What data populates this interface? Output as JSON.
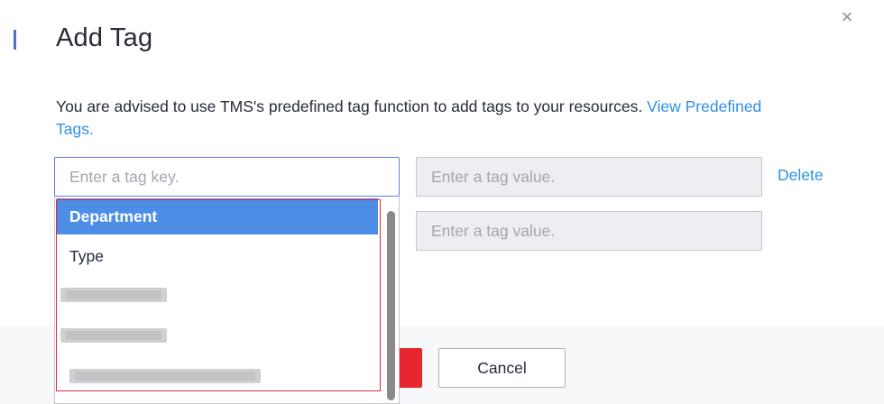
{
  "dialog": {
    "title": "Add Tag",
    "close_icon": "×"
  },
  "advice": {
    "text": "You are advised to use TMS's predefined tag function to add tags to your resources.",
    "link_label": "View Predefined Tags."
  },
  "tag_rows": [
    {
      "key_placeholder": "Enter a tag key.",
      "value_placeholder": "Enter a tag value.",
      "delete_label": "Delete"
    },
    {
      "value_placeholder": "Enter a tag value."
    }
  ],
  "dropdown": {
    "options": [
      {
        "label": "Department",
        "selected": true
      },
      {
        "label": "Type",
        "selected": false
      }
    ],
    "highlight_color": "#e02a38",
    "selected_color": "#4c8de6"
  },
  "footer": {
    "cancel_label": "Cancel",
    "ok_color": "#e8262f"
  },
  "colors": {
    "link": "#2e8fe8",
    "title_accent": "#526ecc"
  }
}
